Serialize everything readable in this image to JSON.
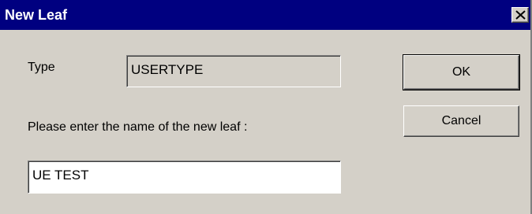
{
  "window": {
    "title": "New Leaf"
  },
  "form": {
    "type_label": "Type",
    "type_value": "USERTYPE",
    "prompt_label": "Please enter the name of the new leaf :",
    "name_value": "UE TEST"
  },
  "buttons": {
    "ok_label": "OK",
    "cancel_label": "Cancel"
  },
  "colors": {
    "titlebar": "#000080",
    "face": "#d4d0c8"
  }
}
